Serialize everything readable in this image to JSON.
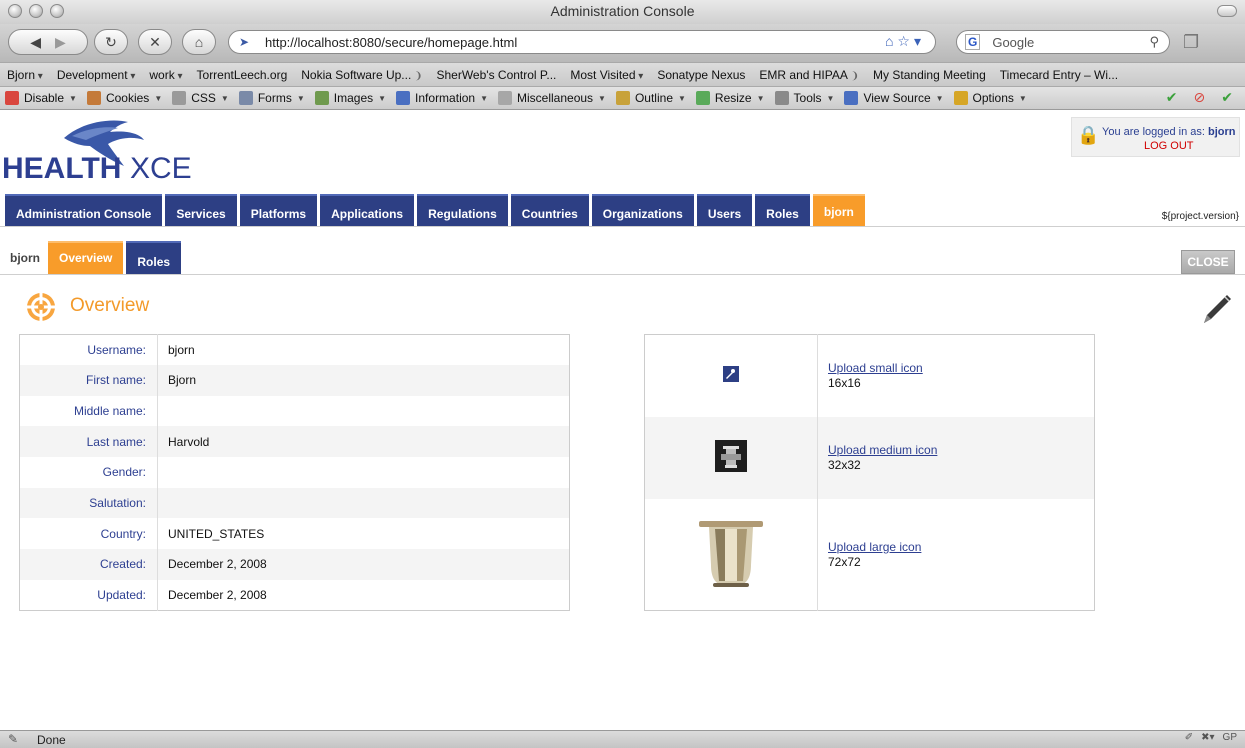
{
  "window": {
    "title": "Administration Console"
  },
  "navbar": {
    "url": "http://localhost:8080/secure/homepage.html",
    "search_engine": "G",
    "search_placeholder": "Google"
  },
  "bookmarks": [
    {
      "label": "Bjorn",
      "icon": "dropdown"
    },
    {
      "label": "Development",
      "icon": "dropdown"
    },
    {
      "label": "work",
      "icon": "dropdown"
    },
    {
      "label": "TorrentLeech.org",
      "icon": ""
    },
    {
      "label": "Nokia Software Up...",
      "icon": "rss"
    },
    {
      "label": "SherWeb's Control P...",
      "icon": ""
    },
    {
      "label": "Most Visited",
      "icon": "dropdown"
    },
    {
      "label": "Sonatype Nexus",
      "icon": ""
    },
    {
      "label": "EMR and HIPAA",
      "icon": "rss"
    },
    {
      "label": "My Standing Meeting",
      "icon": ""
    },
    {
      "label": "Timecard Entry – Wi...",
      "icon": ""
    }
  ],
  "devbar": [
    {
      "label": "Disable",
      "icon": "disable-icon",
      "color": "#d9463e"
    },
    {
      "label": "Cookies",
      "icon": "cookie-icon",
      "color": "#c47a3a"
    },
    {
      "label": "CSS",
      "icon": "css-icon",
      "color": "#9a9a9a"
    },
    {
      "label": "Forms",
      "icon": "forms-icon",
      "color": "#7a8aa8"
    },
    {
      "label": "Images",
      "icon": "images-icon",
      "color": "#6f9a4e"
    },
    {
      "label": "Information",
      "icon": "info-icon",
      "color": "#4a6fc1"
    },
    {
      "label": "Miscellaneous",
      "icon": "misc-icon",
      "color": "#a7a7a7"
    },
    {
      "label": "Outline",
      "icon": "outline-icon",
      "color": "#c8a23a"
    },
    {
      "label": "Resize",
      "icon": "resize-icon",
      "color": "#5aaa5a"
    },
    {
      "label": "Tools",
      "icon": "tools-icon",
      "color": "#8a8a8a"
    },
    {
      "label": "View Source",
      "icon": "view-source-icon",
      "color": "#4a6fc1"
    },
    {
      "label": "Options",
      "icon": "options-icon",
      "color": "#d6a626"
    }
  ],
  "brand": {
    "logo_left": "HEALTH",
    "logo_right": "XCEL",
    "primary_color": "#2d3f84",
    "accent_color": "#f89c2a"
  },
  "login": {
    "prefix": "You are logged in as:",
    "username": "bjorn",
    "logout_label": "LOG OUT"
  },
  "main_tabs": [
    {
      "label": "Administration Console",
      "active": false
    },
    {
      "label": "Services",
      "active": false
    },
    {
      "label": "Platforms",
      "active": false
    },
    {
      "label": "Applications",
      "active": false
    },
    {
      "label": "Regulations",
      "active": false
    },
    {
      "label": "Countries",
      "active": false
    },
    {
      "label": "Organizations",
      "active": false
    },
    {
      "label": "Users",
      "active": false
    },
    {
      "label": "Roles",
      "active": false
    },
    {
      "label": "bjorn",
      "active": true
    }
  ],
  "version": "${project.version}",
  "sub": {
    "crumb": "bjorn",
    "tabs": [
      {
        "label": "Overview",
        "active": true
      },
      {
        "label": "Roles",
        "active": false
      }
    ],
    "close_label": "CLOSE"
  },
  "overview": {
    "title": "Overview",
    "fields": [
      {
        "label": "Username:",
        "value": "bjorn"
      },
      {
        "label": "First name:",
        "value": "Bjorn"
      },
      {
        "label": "Middle name:",
        "value": ""
      },
      {
        "label": "Last name:",
        "value": "Harvold"
      },
      {
        "label": "Gender:",
        "value": ""
      },
      {
        "label": "Salutation:",
        "value": ""
      },
      {
        "label": "Country:",
        "value": "UNITED_STATES"
      },
      {
        "label": "Created:",
        "value": "December 2, 2008"
      },
      {
        "label": "Updated:",
        "value": "December 2, 2008"
      }
    ],
    "icons": [
      {
        "link": "Upload small icon",
        "size": "16x16"
      },
      {
        "link": "Upload medium icon",
        "size": "32x32"
      },
      {
        "link": "Upload large icon",
        "size": "72x72"
      }
    ]
  },
  "status": {
    "text": "Done",
    "badge": "GP"
  }
}
